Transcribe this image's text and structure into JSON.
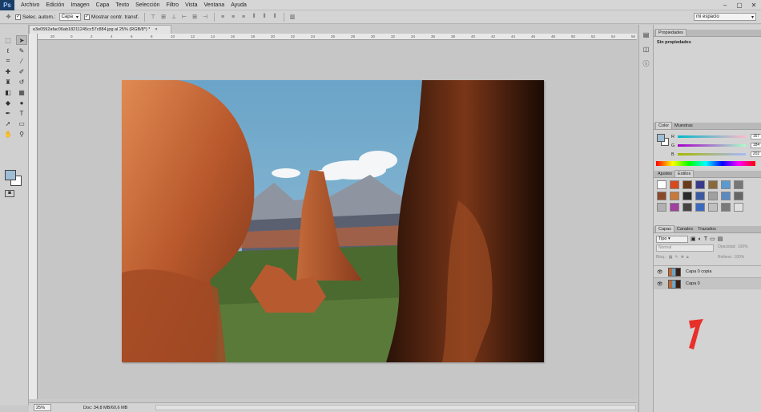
{
  "app": {
    "logo": "Ps"
  },
  "menu": [
    "Archivo",
    "Edición",
    "Imagen",
    "Capa",
    "Texto",
    "Selección",
    "Filtro",
    "Vista",
    "Ventana",
    "Ayuda"
  ],
  "window_controls": [
    "–",
    "▢",
    "✕"
  ],
  "options": {
    "auto_select_label": "Selec. autom.:",
    "auto_select_target": "Capa",
    "show_transform_label": "Mostrar contr. transf.",
    "workspace": "mi espacio"
  },
  "document": {
    "tab_title": "e3e0592afac06ab18211245cc57c884.jpg al 25% (RGB/8*) *",
    "tab_close": "×",
    "ruler_top": [
      "20",
      "0",
      "2",
      "4",
      "6",
      "8",
      "10",
      "12",
      "14",
      "16",
      "18",
      "20",
      "22",
      "24",
      "26",
      "28",
      "30",
      "32",
      "34",
      "36",
      "38",
      "40",
      "42",
      "44",
      "46",
      "48",
      "50",
      "52",
      "54",
      "56"
    ],
    "zoom": "25%",
    "doc_info": "Doc: 34,8 MB/60,6 MB"
  },
  "panels": {
    "properties": {
      "tab": "Propiedades",
      "body": "Sin propiedades"
    },
    "color": {
      "tabs": [
        "Color",
        "Muestras"
      ],
      "channels": [
        {
          "label": "R",
          "value": "167"
        },
        {
          "label": "G",
          "value": "184"
        },
        {
          "label": "B",
          "value": "202"
        }
      ],
      "foreground": "#9fbdd4"
    },
    "styles": {
      "tabs": [
        "Ajustes",
        "Estilos"
      ],
      "swatches": [
        "#ffffff",
        "#d64a1e",
        "#6b3a1a",
        "#3a3a8a",
        "#8a6a3a",
        "#5a9ad0",
        "#777777",
        "#8a4a2a",
        "#c87a3a",
        "#2a2a2a",
        "#3a5aa0",
        "#a0a0a0",
        "#5a8ac0",
        "#666666",
        "#b0b0b0",
        "#a040a0",
        "#444444",
        "#3a6ac0",
        "#c0c0c0",
        "#7a7a7a",
        "#e0e0e0"
      ]
    },
    "layers": {
      "tabs": [
        "Capas",
        "Canales",
        "Trazados"
      ],
      "kind": "Tipo",
      "blend_mode": "Normal",
      "opacity_label": "Opacidad:",
      "opacity_value": "100%",
      "lock_label": "Bloq.:",
      "fill_label": "Relleno:",
      "fill_value": "100%",
      "items": [
        {
          "name": "Capa 0 copia",
          "visible": true
        },
        {
          "name": "Capa 0",
          "visible": true
        }
      ]
    }
  }
}
